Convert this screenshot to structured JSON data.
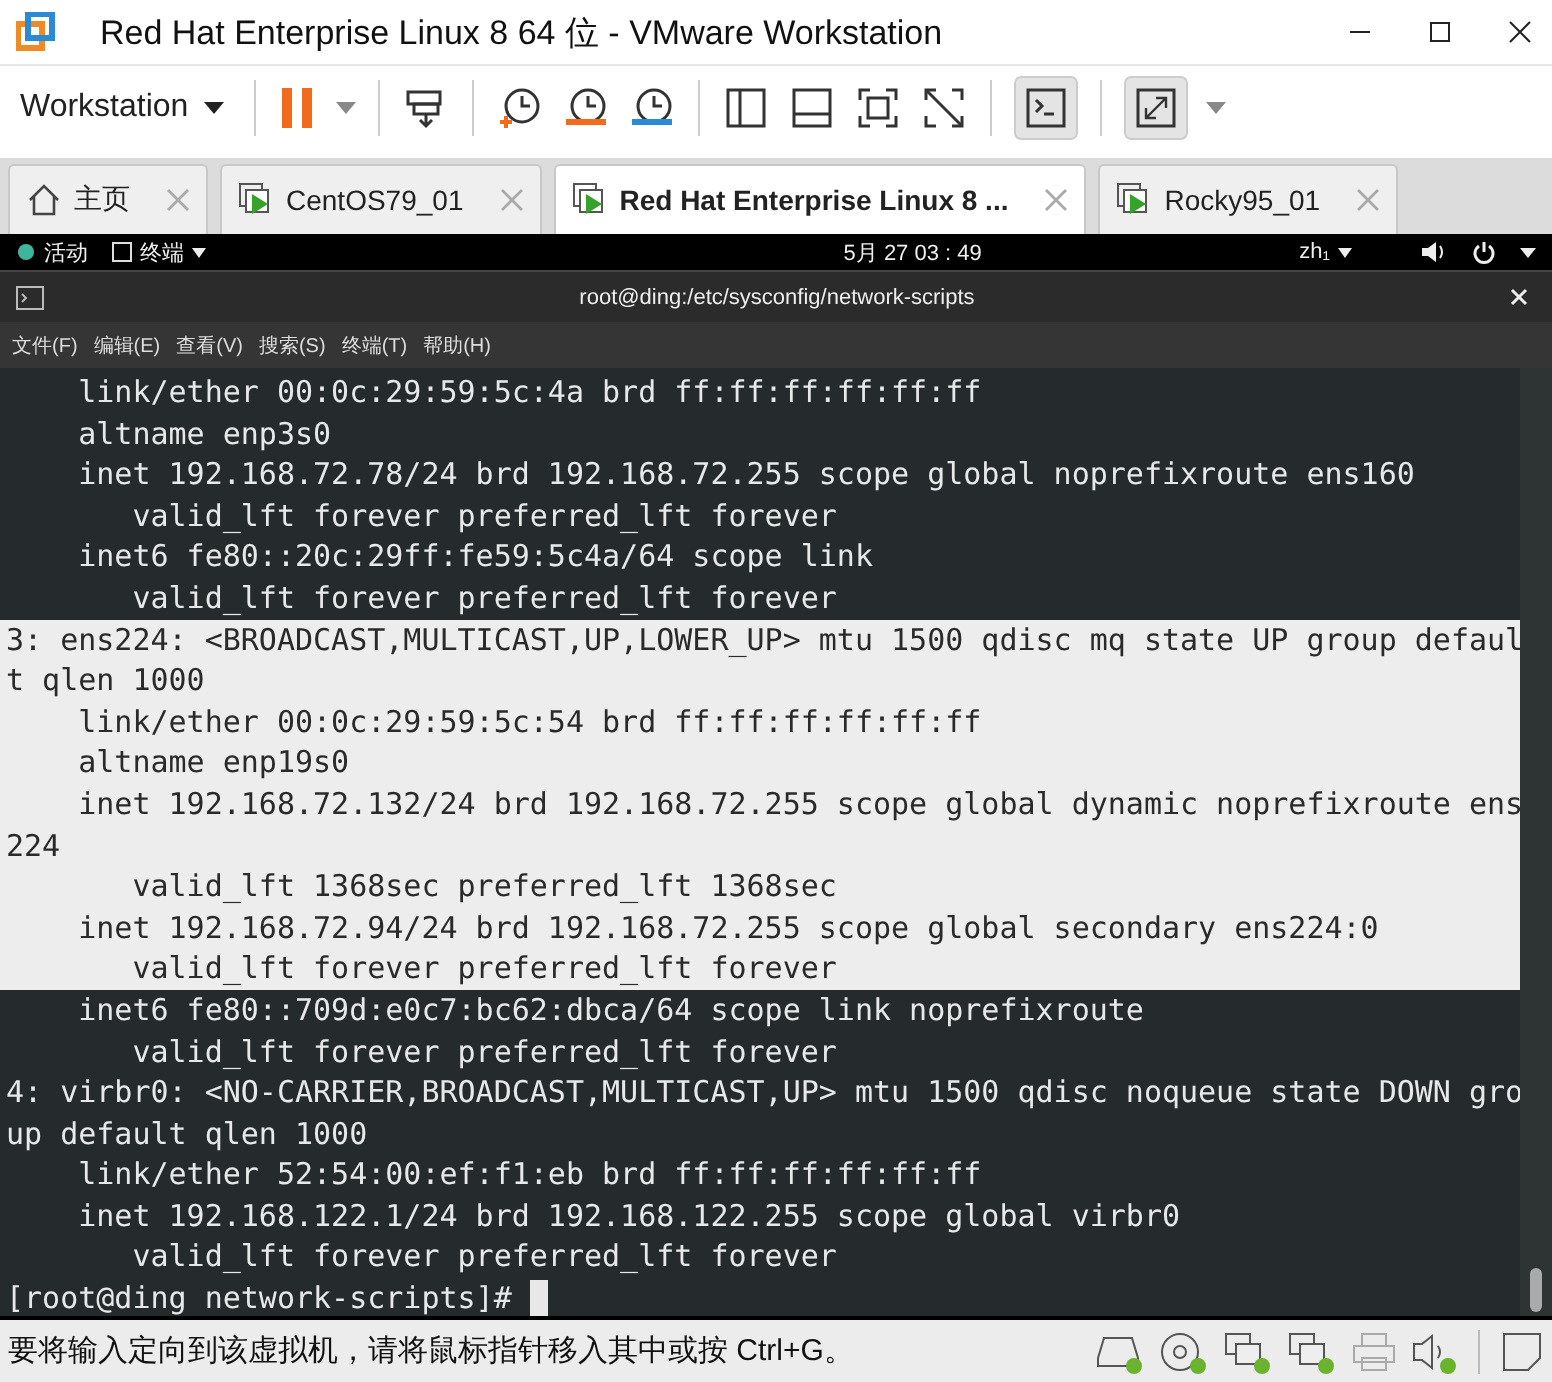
{
  "window": {
    "title": "Red Hat Enterprise Linux 8 64 位 - VMware Workstation"
  },
  "toolbar": {
    "menu_label": "Workstation"
  },
  "tabs": [
    {
      "label": "主页",
      "kind": "home",
      "selected": false
    },
    {
      "label": "CentOS79_01",
      "kind": "vm",
      "selected": false
    },
    {
      "label": "Red Hat Enterprise Linux 8 ...",
      "kind": "vm",
      "selected": true
    },
    {
      "label": "Rocky95_01",
      "kind": "vm",
      "selected": false
    }
  ],
  "gnome_bar": {
    "activities": "活动",
    "app": "终端",
    "clock": "5月 27  03 : 49",
    "input_method": "zh₁"
  },
  "terminal": {
    "title": "root@ding:/etc/sysconfig/network-scripts",
    "menu": [
      "文件(F)",
      "编辑(E)",
      "查看(V)",
      "搜索(S)",
      "终端(T)",
      "帮助(H)"
    ],
    "lines": [
      {
        "text": "    link/ether 00:0c:29:59:5c:4a brd ff:ff:ff:ff:ff:ff",
        "selected": false
      },
      {
        "text": "    altname enp3s0",
        "selected": false
      },
      {
        "text": "    inet 192.168.72.78/24 brd 192.168.72.255 scope global noprefixroute ens160",
        "selected": false
      },
      {
        "text": "       valid_lft forever preferred_lft forever",
        "selected": false
      },
      {
        "text": "    inet6 fe80::20c:29ff:fe59:5c4a/64 scope link",
        "selected": false
      },
      {
        "text": "       valid_lft forever preferred_lft forever",
        "selected": false
      },
      {
        "text": "3: ens224: <BROADCAST,MULTICAST,UP,LOWER_UP> mtu 1500 qdisc mq state UP group defaul",
        "selected": true
      },
      {
        "text": "t qlen 1000",
        "selected": true
      },
      {
        "text": "    link/ether 00:0c:29:59:5c:54 brd ff:ff:ff:ff:ff:ff",
        "selected": true
      },
      {
        "text": "    altname enp19s0",
        "selected": true
      },
      {
        "text": "    inet 192.168.72.132/24 brd 192.168.72.255 scope global dynamic noprefixroute ens",
        "selected": true
      },
      {
        "text": "224",
        "selected": true
      },
      {
        "text": "       valid_lft 1368sec preferred_lft 1368sec",
        "selected": true
      },
      {
        "text": "    inet 192.168.72.94/24 brd 192.168.72.255 scope global secondary ens224:0",
        "selected": true
      },
      {
        "text": "       valid_lft forever preferred_lft forever",
        "selected": true
      },
      {
        "text": "    inet6 fe80::709d:e0c7:bc62:dbca/64 scope link noprefixroute",
        "selected": false
      },
      {
        "text": "       valid_lft forever preferred_lft forever",
        "selected": false
      },
      {
        "text": "4: virbr0: <NO-CARRIER,BROADCAST,MULTICAST,UP> mtu 1500 qdisc noqueue state DOWN gro",
        "selected": false
      },
      {
        "text": "up default qlen 1000",
        "selected": false
      },
      {
        "text": "    link/ether 52:54:00:ef:f1:eb brd ff:ff:ff:ff:ff:ff",
        "selected": false
      },
      {
        "text": "    inet 192.168.122.1/24 brd 192.168.122.255 scope global virbr0",
        "selected": false
      },
      {
        "text": "       valid_lft forever preferred_lft forever",
        "selected": false
      }
    ],
    "prompt": "[root@ding network-scripts]# "
  },
  "status_bar": {
    "message": "要将输入定向到该虚拟机，请将鼠标指针移入其中或按 Ctrl+G。"
  }
}
